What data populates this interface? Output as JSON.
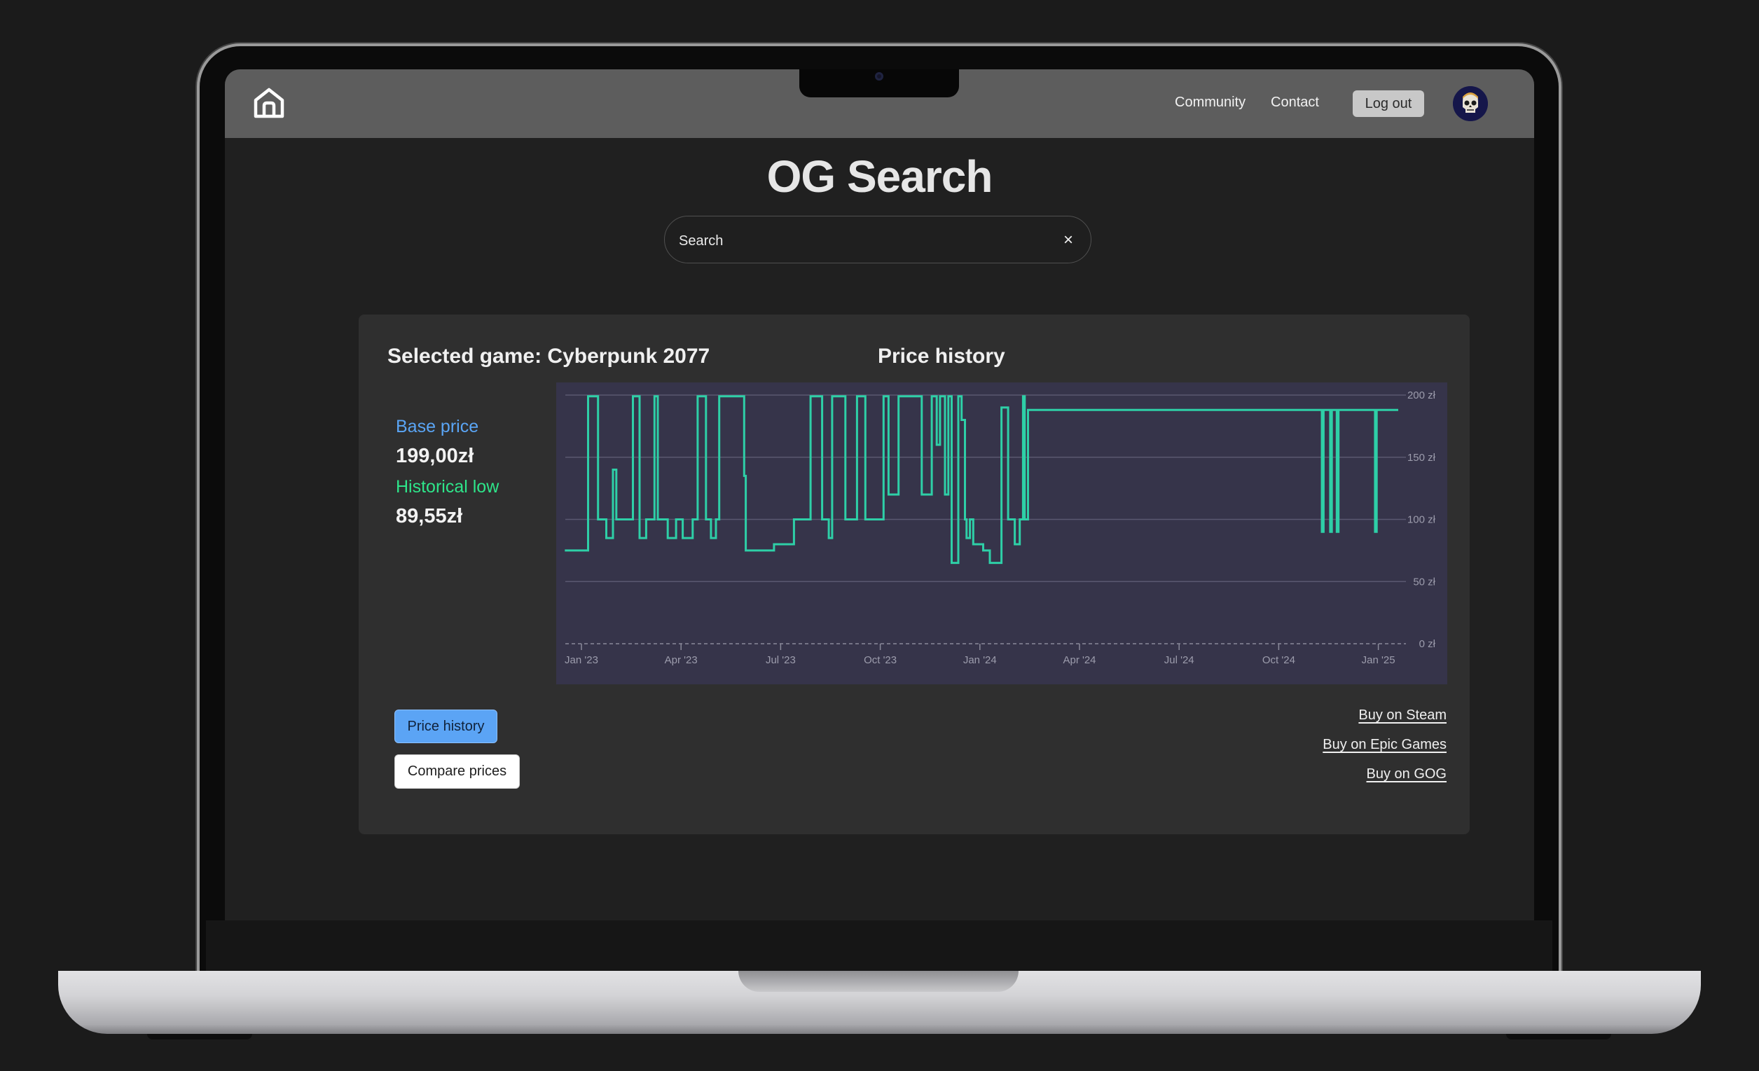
{
  "nav": {
    "community": "Community",
    "contact": "Contact",
    "logout": "Log out"
  },
  "page_title": "OG Search",
  "search": {
    "placeholder": "Search",
    "clear": "×"
  },
  "card": {
    "selected_game": "Selected game: Cyberpunk 2077",
    "chart_title": "Price history",
    "base_price_label": "Base price",
    "base_price_value": "199,00zł",
    "historical_low_label": "Historical low",
    "historical_low_value": "89,55zł",
    "buttons": {
      "price_history": "Price history",
      "compare_prices": "Compare prices"
    },
    "buy_links": [
      "Buy on Steam",
      "Buy on Epic Games",
      "Buy on GOG"
    ]
  },
  "colors": {
    "accent_blue": "#5ba4f5",
    "accent_green": "#2ee58a",
    "chart_line": "#2ecfa7",
    "chart_bg": "#36344a"
  },
  "chart_data": {
    "type": "line",
    "step": true,
    "title": "Price history",
    "xlabel": "",
    "ylabel": "",
    "ylim": [
      0,
      200
    ],
    "yticks": [
      0,
      50,
      100,
      150,
      200
    ],
    "ytick_labels": [
      "0 zł",
      "50 zł",
      "100 zł",
      "150 zł",
      "200 zł"
    ],
    "xlim": [
      0,
      25.4
    ],
    "xticks": [
      0,
      3,
      6,
      9,
      12,
      15,
      18,
      21,
      24
    ],
    "xtick_labels": [
      "Jan '23",
      "Apr '23",
      "Jul '23",
      "Oct '23",
      "Jan '24",
      "Apr '24",
      "Jul '24",
      "Oct '24",
      "Jan '25"
    ],
    "x_unit": "months since Jan '23",
    "grid": "horizontal",
    "series": [
      {
        "points": [
          [
            -0.5,
            75
          ],
          [
            0.2,
            75
          ],
          [
            0.2,
            199
          ],
          [
            0.5,
            199
          ],
          [
            0.5,
            100
          ],
          [
            0.75,
            100
          ],
          [
            0.75,
            85
          ],
          [
            0.95,
            85
          ],
          [
            0.95,
            140
          ],
          [
            1.05,
            140
          ],
          [
            1.05,
            100
          ],
          [
            1.55,
            100
          ],
          [
            1.55,
            199
          ],
          [
            1.75,
            199
          ],
          [
            1.75,
            85
          ],
          [
            1.95,
            85
          ],
          [
            1.95,
            100
          ],
          [
            2.2,
            100
          ],
          [
            2.2,
            199
          ],
          [
            2.3,
            199
          ],
          [
            2.3,
            100
          ],
          [
            2.6,
            100
          ],
          [
            2.6,
            85
          ],
          [
            2.85,
            85
          ],
          [
            2.85,
            100
          ],
          [
            3.05,
            100
          ],
          [
            3.05,
            85
          ],
          [
            3.35,
            85
          ],
          [
            3.35,
            100
          ],
          [
            3.5,
            100
          ],
          [
            3.5,
            199
          ],
          [
            3.75,
            199
          ],
          [
            3.75,
            100
          ],
          [
            3.9,
            100
          ],
          [
            3.9,
            85
          ],
          [
            4.05,
            85
          ],
          [
            4.05,
            100
          ],
          [
            4.15,
            100
          ],
          [
            4.15,
            199
          ],
          [
            4.9,
            199
          ],
          [
            4.9,
            135
          ],
          [
            4.95,
            135
          ],
          [
            4.95,
            75
          ],
          [
            5.8,
            75
          ],
          [
            5.8,
            80
          ],
          [
            6.4,
            80
          ],
          [
            6.4,
            100
          ],
          [
            6.9,
            100
          ],
          [
            6.9,
            199
          ],
          [
            7.25,
            199
          ],
          [
            7.25,
            100
          ],
          [
            7.45,
            100
          ],
          [
            7.45,
            85
          ],
          [
            7.55,
            85
          ],
          [
            7.55,
            199
          ],
          [
            7.95,
            199
          ],
          [
            7.95,
            100
          ],
          [
            8.3,
            100
          ],
          [
            8.3,
            199
          ],
          [
            8.55,
            199
          ],
          [
            8.55,
            100
          ],
          [
            9.1,
            100
          ],
          [
            9.1,
            199
          ],
          [
            9.25,
            199
          ],
          [
            9.25,
            120
          ],
          [
            9.55,
            120
          ],
          [
            9.55,
            199
          ],
          [
            10.25,
            199
          ],
          [
            10.25,
            120
          ],
          [
            10.55,
            120
          ],
          [
            10.55,
            199
          ],
          [
            10.7,
            199
          ],
          [
            10.7,
            160
          ],
          [
            10.8,
            160
          ],
          [
            10.8,
            199
          ],
          [
            10.95,
            199
          ],
          [
            10.95,
            120
          ],
          [
            11.05,
            120
          ],
          [
            11.05,
            199
          ],
          [
            11.15,
            199
          ],
          [
            11.15,
            65
          ],
          [
            11.35,
            65
          ],
          [
            11.35,
            199
          ],
          [
            11.45,
            199
          ],
          [
            11.45,
            180
          ],
          [
            11.55,
            180
          ],
          [
            11.55,
            100
          ],
          [
            11.6,
            100
          ],
          [
            11.6,
            85
          ],
          [
            11.7,
            85
          ],
          [
            11.7,
            100
          ],
          [
            11.8,
            100
          ],
          [
            11.8,
            80
          ],
          [
            12.1,
            80
          ],
          [
            12.1,
            75
          ],
          [
            12.3,
            75
          ],
          [
            12.3,
            65
          ],
          [
            12.65,
            65
          ],
          [
            12.65,
            190
          ],
          [
            12.85,
            190
          ],
          [
            12.85,
            100
          ],
          [
            13.05,
            100
          ],
          [
            13.05,
            80
          ],
          [
            13.2,
            80
          ],
          [
            13.2,
            100
          ],
          [
            13.3,
            100
          ],
          [
            13.3,
            199
          ],
          [
            13.35,
            199
          ],
          [
            13.35,
            100
          ],
          [
            13.45,
            100
          ],
          [
            13.45,
            188
          ],
          [
            22.3,
            188
          ],
          [
            22.3,
            90
          ],
          [
            22.35,
            90
          ],
          [
            22.35,
            188
          ],
          [
            22.55,
            188
          ],
          [
            22.55,
            90
          ],
          [
            22.6,
            90
          ],
          [
            22.6,
            188
          ],
          [
            22.75,
            188
          ],
          [
            22.75,
            90
          ],
          [
            22.8,
            90
          ],
          [
            22.8,
            188
          ],
          [
            23.9,
            188
          ],
          [
            23.9,
            90
          ],
          [
            23.95,
            90
          ],
          [
            23.95,
            188
          ],
          [
            24.6,
            188
          ]
        ]
      }
    ]
  }
}
